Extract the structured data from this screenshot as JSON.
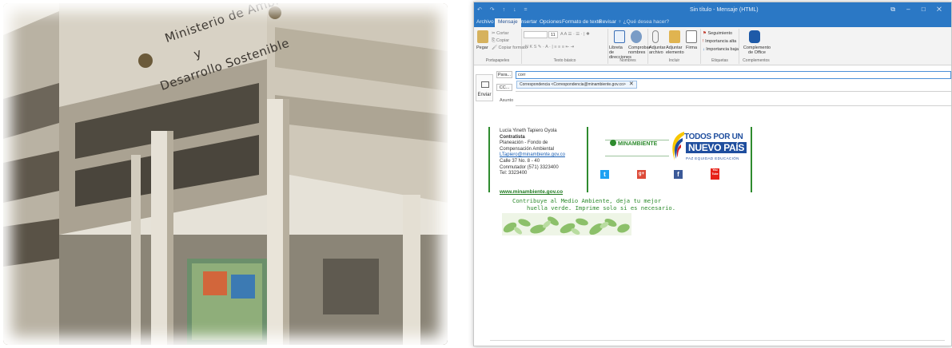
{
  "photo": {
    "sign_line1": "Ministerio de Ambiente",
    "sign_line2": "y",
    "sign_line3": "Desarrollo Sostenible"
  },
  "window": {
    "quick_access": "↶ ↷ ↑ ↓ =",
    "title": "Sin título - Mensaje (HTML)",
    "controls": "⧉ – □ ✕"
  },
  "tabs": [
    "Archivo",
    "Mensaje",
    "Insertar",
    "Opciones",
    "Formato de texto",
    "Revisar",
    "♀ ¿Qué desea hacer?"
  ],
  "ribbon": {
    "clipboard": {
      "paste": "Pegar",
      "cut": "✂ Cortar",
      "copy": "⎘ Copiar",
      "format": "🖌 Copiar formato",
      "label": "Portapapeles"
    },
    "basic_text": {
      "font_size": "11",
      "format_row1": "A A  ☰ · ☰ · | ✱",
      "format_row2": "N K S  ✎ · A · | ≡ ≡ ≡  ⇤ ⇥",
      "label": "Texto básico"
    },
    "names": {
      "book": "Libreta de direcciones",
      "check": "Comprobar nombres",
      "label": "Nombres"
    },
    "include": {
      "attach_file": "Adjuntar archivo",
      "attach_item": "Adjuntar elemento",
      "signature": "Firma",
      "label": "Incluir"
    },
    "tags": {
      "follow": "Seguimiento",
      "high": "Importancia alta",
      "low": "Importancia baja",
      "label": "Etiquetas"
    },
    "addins": {
      "label_btn": "Complemento de Office",
      "label": "Complementos"
    }
  },
  "compose": {
    "send": "Enviar",
    "to_btn": "Para...",
    "cc_btn": "CC...",
    "subject": "Asunto",
    "to_value": "corr",
    "autocomplete": "Correspondencia <Correspondencia@minambiente.gov.co>"
  },
  "signature": {
    "name": "Lucía Yineth Tapiero Oyola",
    "role": "Contratista",
    "dept1": "Planeación - Fondo de",
    "dept2": "Compensación Ambiental",
    "email": "LTapiero@minambiente.gov.co",
    "address": "Calle 37 No. 8 - 40",
    "phone": "Conmutador (571) 3323400",
    "ext": "Tel: 3323400",
    "web": "www.minambiente.gov.co",
    "brand": "MINAMBIENTE",
    "gov_line1": "TODOS POR UN",
    "gov_line2": "NUEVO PAÍS",
    "gov_line3": "PAZ  EQUIDAD  EDUCACIÓN",
    "eco1": "Contribuye al Medio Ambiente, deja tu mejor",
    "eco2": "huella verde. Imprime solo si es necesario.",
    "social": [
      "t",
      "g+",
      "f",
      "You Tube"
    ]
  },
  "colors": {
    "outlook_blue": "#2b78c5",
    "green": "#2e8b2e",
    "twitter": "#1da1f2",
    "gplus": "#dd4b39",
    "facebook": "#3b5998",
    "youtube": "#e62117"
  }
}
